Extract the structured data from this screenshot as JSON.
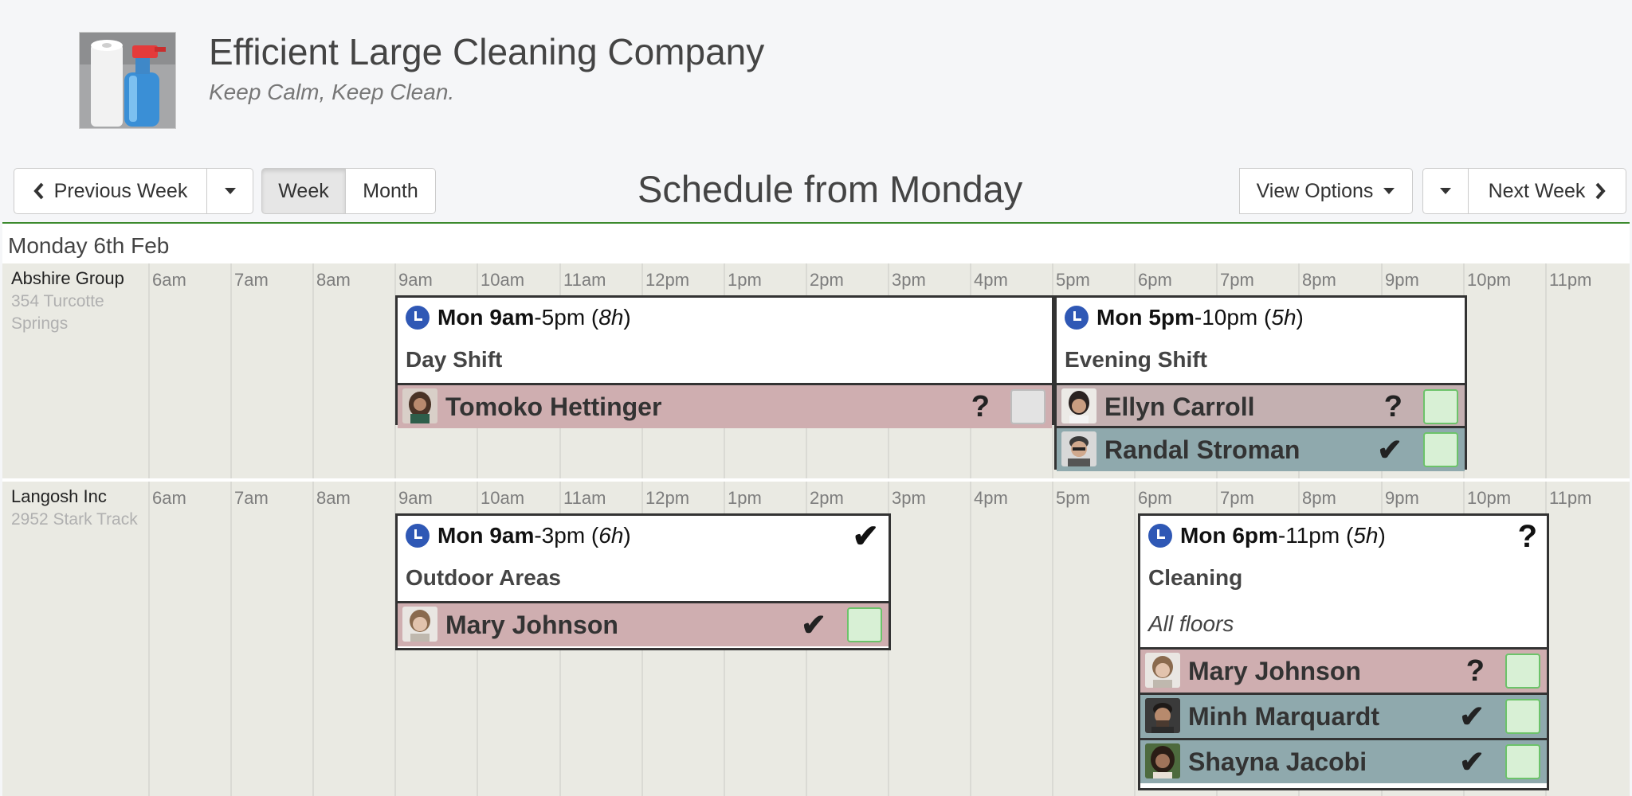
{
  "company": {
    "name": "Efficient Large Cleaning Company",
    "tagline": "Keep Calm, Keep Clean."
  },
  "toolbar": {
    "previous_week": "Previous Week",
    "week": "Week",
    "month": "Month",
    "view_options": "View Options",
    "next_week": "Next Week",
    "active_view": "Week"
  },
  "schedule": {
    "title": "Schedule from Monday",
    "date_heading": "Monday 6th Feb",
    "hours": [
      "6am",
      "7am",
      "8am",
      "9am",
      "10am",
      "11am",
      "12pm",
      "1pm",
      "2pm",
      "3pm",
      "4pm",
      "5pm",
      "6pm",
      "7pm",
      "8pm",
      "9pm",
      "10pm",
      "11pm"
    ],
    "clients": [
      {
        "name": "Abshire Group",
        "address": "354 Turcotte Springs",
        "shifts": [
          {
            "day": "Mon",
            "start": "9am",
            "end": "-5pm",
            "duration": "8h",
            "name": "Day Shift",
            "note": "",
            "status": "",
            "staff": [
              {
                "name": "Tomoko Hettinger",
                "status": "?",
                "checked": false,
                "color": "#cfaeb0"
              }
            ]
          },
          {
            "day": "Mon",
            "start": "5pm",
            "end": "-10pm",
            "duration": "5h",
            "name": "Evening Shift",
            "note": "",
            "status": "",
            "staff": [
              {
                "name": "Ellyn Carroll",
                "status": "?",
                "checked": true,
                "color": "#c4b0b1"
              },
              {
                "name": "Randal Stroman",
                "status": "✔",
                "checked": true,
                "color": "#8fa9ad"
              }
            ]
          }
        ]
      },
      {
        "name": "Langosh Inc",
        "address": "2952 Stark Track",
        "shifts": [
          {
            "day": "Mon",
            "start": "9am",
            "end": "-3pm",
            "duration": "6h",
            "name": "Outdoor Areas",
            "note": "",
            "status": "✔",
            "staff": [
              {
                "name": "Mary Johnson",
                "status": "✔",
                "checked": true,
                "color": "#cfaeb0"
              }
            ]
          },
          {
            "day": "Mon",
            "start": "6pm",
            "end": "-11pm",
            "duration": "5h",
            "name": "Cleaning",
            "note": "All floors",
            "status": "?",
            "staff": [
              {
                "name": "Mary Johnson",
                "status": "?",
                "checked": true,
                "color": "#cfaeb0"
              },
              {
                "name": "Minh Marquardt",
                "status": "✔",
                "checked": true,
                "color": "#8fa9ad"
              },
              {
                "name": "Shayna Jacobi",
                "status": "✔",
                "checked": true,
                "color": "#8fa9ad"
              }
            ]
          }
        ]
      }
    ]
  },
  "icons": {
    "clock": "clock-icon",
    "prev": "chevron-left-icon",
    "next": "chevron-right-icon",
    "caret": "caret-down-icon"
  }
}
